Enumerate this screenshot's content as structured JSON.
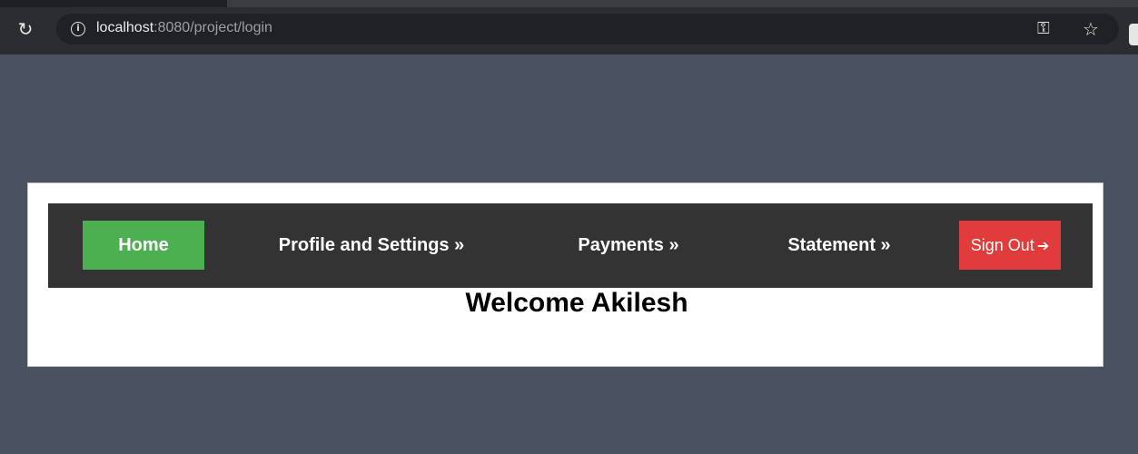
{
  "browser": {
    "reload_icon": "reload-icon",
    "info_icon": "info-icon",
    "url_host": "localhost",
    "url_rest": ":8080/project/login",
    "key_icon": "key-icon",
    "star_icon": "star-icon"
  },
  "nav": {
    "home": "Home",
    "profile": "Profile and Settings »",
    "payments": "Payments »",
    "statement": "Statement »",
    "signout": "Sign Out"
  },
  "main": {
    "welcome": "Welcome Akilesh"
  },
  "colors": {
    "page_bg": "#4a5160",
    "navbar_bg": "#333333",
    "home_active": "#4caf50",
    "signout_bg": "#e03c3c"
  }
}
